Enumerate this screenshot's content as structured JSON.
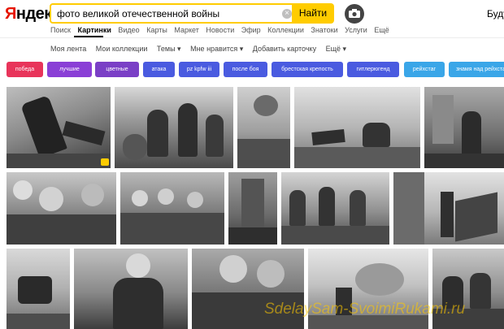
{
  "header": {
    "logo_first": "Я",
    "logo_rest": "ндекс",
    "search_value": "фото великой отечественной войны",
    "search_button": "Найти",
    "user_link": "Буду"
  },
  "services": [
    "Поиск",
    "Картинки",
    "Видео",
    "Карты",
    "Маркет",
    "Новости",
    "Эфир",
    "Коллекции",
    "Знатоки",
    "Услуги",
    "Ещё"
  ],
  "subnav": [
    "Моя лента",
    "Мои коллекции",
    "Темы ▾",
    "Мне нравится ▾",
    "Добавить карточку",
    "Ещё ▾"
  ],
  "chips": [
    {
      "label": "победа",
      "color": "#e8345a"
    },
    {
      "label": "лучшие",
      "color": "#8a3fd6"
    },
    {
      "label": "цветные",
      "color": "#7a3fc6"
    },
    {
      "label": "атака",
      "color": "#4a5be0"
    },
    {
      "label": "pz kpfw iii",
      "color": "#4a5be0"
    },
    {
      "label": "после боя",
      "color": "#4a5be0"
    },
    {
      "label": "брестская крепость",
      "color": "#4a5be0"
    },
    {
      "label": "гитлерюгенд",
      "color": "#4a5be0"
    },
    {
      "label": "рейхстаг",
      "color": "#3aa6e8"
    },
    {
      "label": "знамя над рейхстагом",
      "color": "#3aa6e8"
    }
  ],
  "colors": {
    "accent": "#ffcc00",
    "brand_red": "#e61400"
  },
  "icons": [
    "clear-icon",
    "camera-icon"
  ],
  "watermark": "SdelaySam-SvoimiRukami.ru"
}
